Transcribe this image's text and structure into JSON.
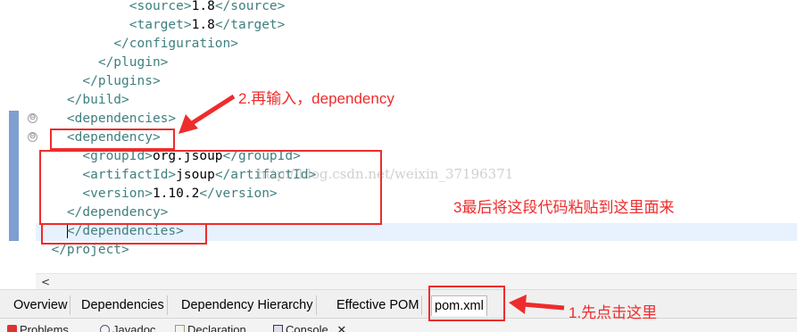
{
  "code_lines": [
    {
      "indent": "            ",
      "open": "<source>",
      "text": "1.8",
      "close": "</source>"
    },
    {
      "indent": "            ",
      "open": "<target>",
      "text": "1.8",
      "close": "</target>"
    },
    {
      "indent": "          ",
      "open": "",
      "text": "",
      "close": "</configuration>"
    },
    {
      "indent": "        ",
      "open": "",
      "text": "",
      "close": "</plugin>"
    },
    {
      "indent": "      ",
      "open": "",
      "text": "",
      "close": "</plugins>"
    },
    {
      "indent": "    ",
      "open": "",
      "text": "",
      "close": "</build>"
    },
    {
      "indent": "    ",
      "open": "<dependencies>",
      "text": "",
      "close": ""
    },
    {
      "indent": "    ",
      "open": "<dependency>",
      "text": "",
      "close": ""
    },
    {
      "indent": "      ",
      "open": "<groupId>",
      "text": "org.jsoup",
      "close": "</groupId>"
    },
    {
      "indent": "      ",
      "open": "<artifactId>",
      "text": "jsoup",
      "close": "</artifactId>"
    },
    {
      "indent": "      ",
      "open": "<version>",
      "text": "1.10.2",
      "close": "</version>"
    },
    {
      "indent": "    ",
      "open": "",
      "text": "",
      "close": "</dependency>"
    },
    {
      "indent": "    ",
      "open": "",
      "text": "",
      "close": "</dependencies>"
    },
    {
      "indent": "  ",
      "open": "",
      "text": "",
      "close": "</project>"
    }
  ],
  "watermark": "http://blog.csdn.net/weixin_37196371",
  "editor_tabs": [
    "Overview",
    "Dependencies",
    "Dependency Hierarchy",
    "Effective POM",
    "pom.xml"
  ],
  "active_tab": "pom.xml",
  "views": [
    "Problems",
    "Javadoc",
    "Declaration",
    "Console"
  ],
  "annotations": {
    "step1": "1.先点击这里",
    "step2": "2.再输入，dependency",
    "step3": "3最后将这段代码粘贴到这里面来"
  },
  "colors": {
    "tag": "#3f7f7f",
    "annotation": "#ee2c2c",
    "change_bar": "#7f9fd0"
  }
}
